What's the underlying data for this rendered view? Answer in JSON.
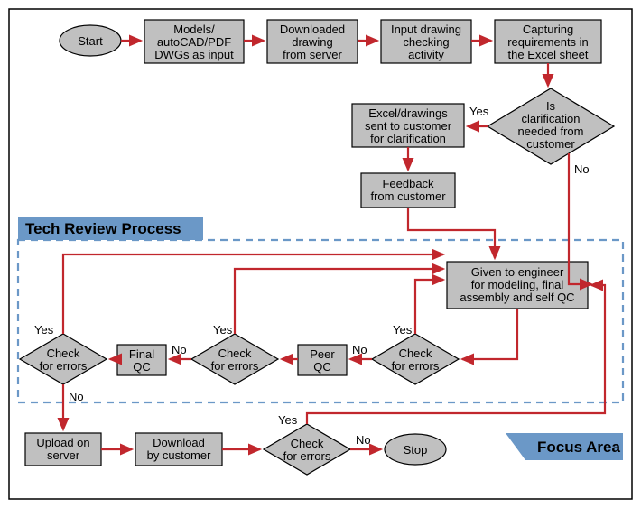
{
  "nodes": {
    "start": "Start",
    "models_l1": "Models/",
    "models_l2": "autoCAD/PDF",
    "models_l3": "DWGs as input",
    "downloaded_l1": "Downloaded",
    "downloaded_l2": "drawing",
    "downloaded_l3": "from server",
    "inputcheck_l1": "Input drawing",
    "inputcheck_l2": "checking",
    "inputcheck_l3": "activity",
    "capture_l1": "Capturing",
    "capture_l2": "requirements in",
    "capture_l3": "the Excel sheet",
    "sentclarify_l1": "Excel/drawings",
    "sentclarify_l2": "sent to customer",
    "sentclarify_l3": "for clarification",
    "feedback_l1": "Feedback",
    "feedback_l2": "from customer",
    "clarify_l1": "Is",
    "clarify_l2": "clarification",
    "clarify_l3": "needed from",
    "clarify_l4": "customer",
    "engineer_l1": "Given to engineer",
    "engineer_l2": "for modeling, final",
    "engineer_l3": "assembly and self QC",
    "chkerr_l1": "Check",
    "chkerr_l2": "for errors",
    "peerqc_l1": "Peer",
    "peerqc_l2": "QC",
    "finalqc_l1": "Final",
    "finalqc_l2": "QC",
    "upload_l1": "Upload on",
    "upload_l2": "server",
    "download_l1": "Download",
    "download_l2": "by customer",
    "stop": "Stop"
  },
  "labels": {
    "yes": "Yes",
    "no": "No",
    "techreview": "Tech Review Process",
    "focusarea": "Focus Area"
  }
}
